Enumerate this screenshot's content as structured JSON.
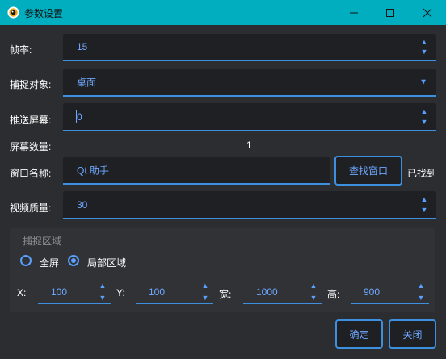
{
  "window": {
    "title": "参数设置",
    "minimize_symbol": "—",
    "maximize_symbol": "☐",
    "close_symbol": "✕"
  },
  "form": {
    "fps_label": "帧率:",
    "fps_value": "15",
    "capture_target_label": "捕捉对象:",
    "capture_target_value": "桌面",
    "push_screen_label": "推送屏幕:",
    "push_screen_value": "0",
    "screen_count_label": "屏幕数量:",
    "screen_count_value": "1",
    "window_name_label": "窗口名称:",
    "window_name_value": "Qt 助手",
    "find_window_button": "查找窗口",
    "found_status": "已找到",
    "video_quality_label": "视频质量:",
    "video_quality_value": "30"
  },
  "capture_region": {
    "title": "捕捉区域",
    "options": [
      {
        "label": "全屏",
        "checked": false
      },
      {
        "label": "局部区域",
        "checked": true
      }
    ],
    "x_label": "X:",
    "x_value": "100",
    "y_label": "Y:",
    "y_value": "100",
    "width_label": "宽:",
    "width_value": "1000",
    "height_label": "高:",
    "height_value": "900"
  },
  "footer": {
    "ok_button": "确定",
    "close_button": "关闭"
  },
  "icons": {
    "spin_up": "▲",
    "spin_down": "▼",
    "dropdown": "▼"
  },
  "colors": {
    "titlebar": "#00aebf",
    "background": "#2b2d31",
    "field_background": "#1f2024",
    "accent": "#3d8fe0",
    "value_text": "#6ea8ff"
  }
}
